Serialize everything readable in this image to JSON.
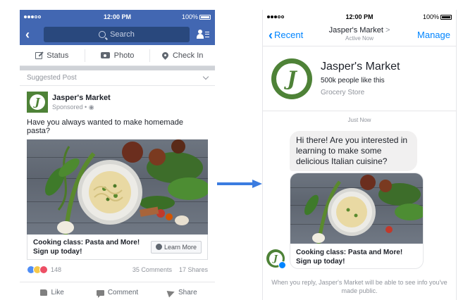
{
  "left_phone": {
    "status_bar": {
      "time": "12:00 PM",
      "battery": "100%"
    },
    "nav": {
      "search_label": "Search"
    },
    "composer": {
      "status": "Status",
      "photo": "Photo",
      "check_in": "Check In"
    },
    "post": {
      "suggested_label": "Suggested Post",
      "page_name": "Jasper's Market",
      "sponsored": "Sponsored • ",
      "text": "Have you always wanted to make homemade pasta?",
      "cta_line1": "Cooking class: Pasta and More!",
      "cta_line2": "Sign up today!",
      "learn_more": "Learn More",
      "reaction_count": "148",
      "comments": "35 Comments",
      "shares": "17 Shares",
      "actions": {
        "like": "Like",
        "comment": "Comment",
        "share": "Share"
      }
    }
  },
  "right_phone": {
    "status_bar": {
      "time": "12:00 PM",
      "battery": "100%"
    },
    "nav": {
      "back": "Recent",
      "title": "Jasper's Market",
      "title_chevron": ">",
      "subtitle": "Active Now",
      "manage": "Manage"
    },
    "page_header": {
      "name": "Jasper's Market",
      "likes": "500k people like this",
      "category": "Grocery Store"
    },
    "timestamp": "Just Now",
    "message": "Hi there! Are you interested in learning to make some delicious Italian cuisine?",
    "card": {
      "line1": "Cooking class: Pasta and More!",
      "line2": "Sign up today!"
    },
    "reply_note": "When you reply, Jasper's Market will be able to see info you've made public."
  },
  "colors": {
    "facebook_blue": "#4267b2",
    "messenger_blue": "#0084ff",
    "brand_green": "#4e8237",
    "arrow_blue": "#3b7ce0"
  },
  "icons": [
    "search-icon",
    "friends-icon",
    "pen-icon",
    "camera-icon",
    "pin-icon",
    "chevron-down-icon",
    "messenger-icon",
    "like-icon",
    "comment-icon",
    "share-icon",
    "back-chevron-icon"
  ]
}
